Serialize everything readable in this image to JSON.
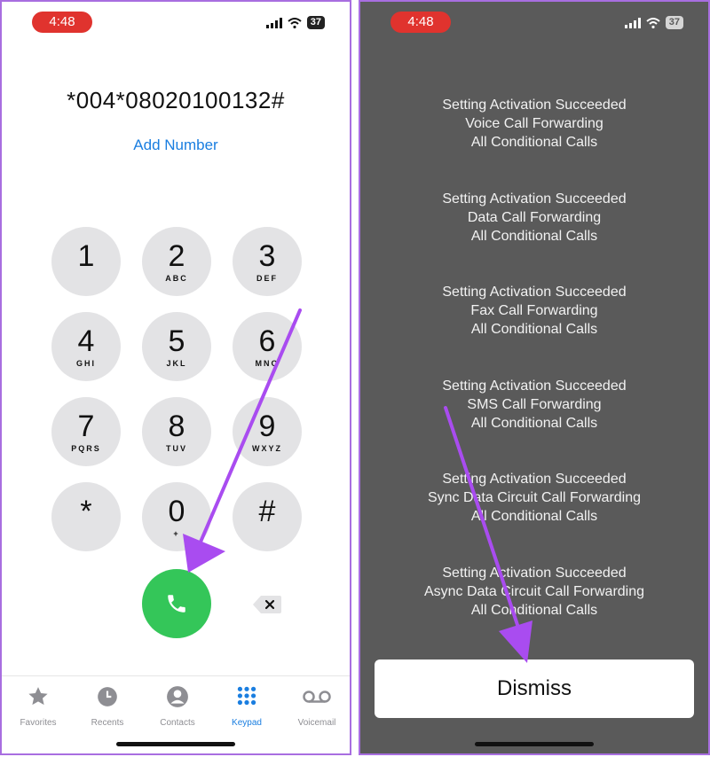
{
  "left": {
    "status": {
      "time": "4:48",
      "battery": "37"
    },
    "dialed_number": "*004*08020100132#",
    "add_number_label": "Add Number",
    "keys": [
      {
        "digit": "1",
        "letters": ""
      },
      {
        "digit": "2",
        "letters": "ABC"
      },
      {
        "digit": "3",
        "letters": "DEF"
      },
      {
        "digit": "4",
        "letters": "GHI"
      },
      {
        "digit": "5",
        "letters": "JKL"
      },
      {
        "digit": "6",
        "letters": "MNO"
      },
      {
        "digit": "7",
        "letters": "PQRS"
      },
      {
        "digit": "8",
        "letters": "TUV"
      },
      {
        "digit": "9",
        "letters": "WXYZ"
      },
      {
        "digit": "*",
        "letters": ""
      },
      {
        "digit": "0",
        "letters": "+"
      },
      {
        "digit": "#",
        "letters": ""
      }
    ],
    "tabs": [
      {
        "label": "Favorites",
        "icon": "star-icon"
      },
      {
        "label": "Recents",
        "icon": "clock-icon"
      },
      {
        "label": "Contacts",
        "icon": "person-icon"
      },
      {
        "label": "Keypad",
        "icon": "keypad-icon",
        "active": true
      },
      {
        "label": "Voicemail",
        "icon": "voicemail-icon"
      }
    ],
    "accent_color": "#1a7ee0",
    "call_color": "#34c659"
  },
  "right": {
    "status": {
      "time": "4:48",
      "battery": "37"
    },
    "messages": [
      {
        "title": "Setting Activation Succeeded",
        "service": "Voice Call Forwarding",
        "condition": "All Conditional Calls"
      },
      {
        "title": "Setting Activation Succeeded",
        "service": "Data Call Forwarding",
        "condition": "All Conditional Calls"
      },
      {
        "title": "Setting Activation Succeeded",
        "service": "Fax Call Forwarding",
        "condition": "All Conditional Calls"
      },
      {
        "title": "Setting Activation Succeeded",
        "service": "SMS Call Forwarding",
        "condition": "All Conditional Calls"
      },
      {
        "title": "Setting Activation Succeeded",
        "service": "Sync Data Circuit Call Forwarding",
        "condition": "All Conditional Calls"
      },
      {
        "title": "Setting Activation Succeeded",
        "service": "Async Data Circuit Call Forwarding",
        "condition": "All Conditional Calls"
      }
    ],
    "dismiss_label": "Dismiss"
  },
  "annotation_color": "#a94cf0"
}
